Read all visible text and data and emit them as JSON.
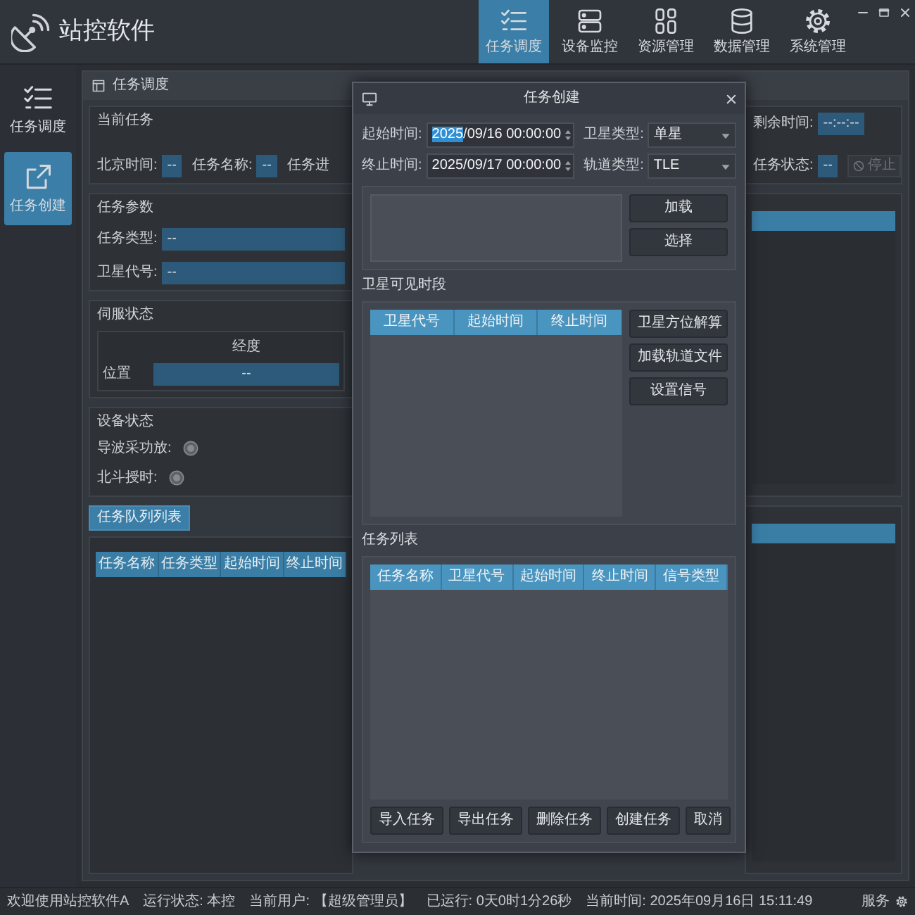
{
  "app": {
    "title": "站控软件"
  },
  "nav": [
    {
      "label": "任务调度",
      "selected": true
    },
    {
      "label": "设备监控",
      "selected": false
    },
    {
      "label": "资源管理",
      "selected": false
    },
    {
      "label": "数据管理",
      "selected": false
    },
    {
      "label": "系统管理",
      "selected": false
    }
  ],
  "sidebar": {
    "items": [
      {
        "label": "任务调度",
        "selected": false
      },
      {
        "label": "任务创建",
        "selected": true
      }
    ]
  },
  "panel": {
    "title": "任务调度",
    "current_task": {
      "title": "当前任务",
      "fields": [
        {
          "label": "北京时间:",
          "value": "--"
        },
        {
          "label": "任务名称:",
          "value": "--"
        }
      ],
      "partial_label": "任务进",
      "remaining_time": {
        "label": "剩余时间:",
        "value": "--:--:--"
      },
      "task_status": {
        "label": "任务状态:",
        "value": "--"
      },
      "stop_button": {
        "label": "停止",
        "disabled": true
      }
    },
    "task_params": {
      "title": "任务参数",
      "task_type": {
        "label": "任务类型:",
        "value": "--"
      },
      "satellite_code": {
        "label": "卫星代号:",
        "value": "--"
      }
    },
    "servo_status": {
      "title": "伺服状态",
      "column": "经度",
      "rows": [
        {
          "label": "位置",
          "value": "--"
        }
      ]
    },
    "device_status": {
      "title": "设备状态",
      "items": [
        {
          "label": "导波采功放:",
          "on": false
        },
        {
          "label": "北斗授时:",
          "on": false
        }
      ]
    },
    "queue": {
      "tab": "任务队列列表",
      "columns": [
        "任务名称",
        "任务类型",
        "起始时间",
        "终止时间"
      ]
    }
  },
  "dialog": {
    "title": "任务创建",
    "fields": [
      {
        "kind": "datetime",
        "label": "起始时间:",
        "value": "2025/09/16 00:00:00",
        "year_highlighted": true
      },
      {
        "kind": "datetime",
        "label": "终止时间:",
        "value": "2025/09/17 00:00:00",
        "year_highlighted": false
      },
      {
        "kind": "combo",
        "label": "卫星类型:",
        "value": "单星"
      },
      {
        "kind": "combo",
        "label": "轨道类型:",
        "value": "TLE"
      }
    ],
    "file_buttons": [
      "加载",
      "选择"
    ],
    "visible_windows": {
      "title": "卫星可见时段",
      "columns": [
        "卫星代号",
        "起始时间",
        "终止时间"
      ],
      "buttons": [
        "卫星方位解算",
        "加载轨道文件",
        "设置信号"
      ]
    },
    "task_list": {
      "title": "任务列表",
      "columns": [
        "任务名称",
        "卫星代号",
        "起始时间",
        "终止时间",
        "信号类型"
      ],
      "buttons": [
        "导入任务",
        "导出任务",
        "删除任务"
      ],
      "footer_buttons": [
        "创建任务",
        "取消"
      ]
    }
  },
  "status_bar": {
    "items": [
      "欢迎使用站控软件A",
      "运行状态: 本控",
      "当前用户: 【超级管理员】",
      "已运行: 0天0时1分26秒",
      "当前时间: 2025年09月16日 15:11:49"
    ],
    "right": "服务"
  }
}
